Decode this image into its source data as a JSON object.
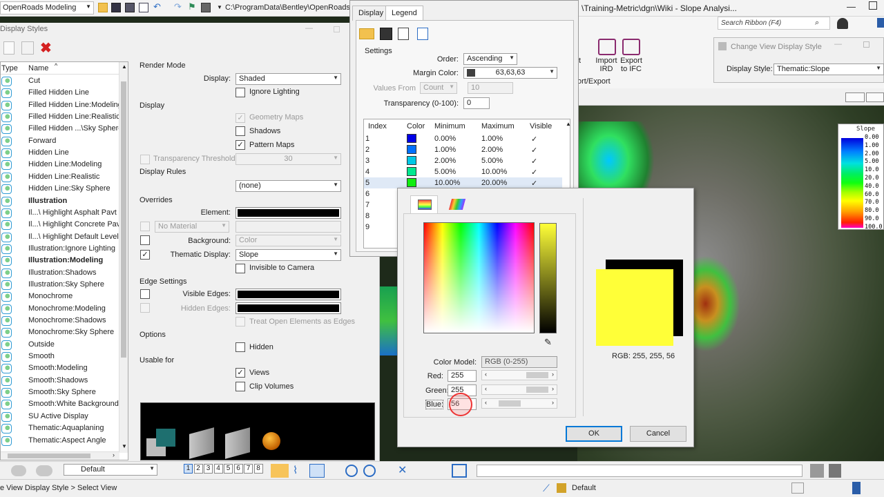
{
  "topbar": {
    "workspace": "OpenRoads Modeling",
    "path": "C:\\ProgramData\\Bentley\\OpenRoads",
    "title": "\\Training-Metric\\dgn\\Wiki - Slope Analysi...",
    "search_placeholder": "Search Ribbon (F4)"
  },
  "ribbon": {
    "frag": "t",
    "import_ird": "Import IRD",
    "import_label1": "Import",
    "import_label2": "IRD",
    "export_label1": "Export",
    "export_label2": "to IFC",
    "group": "ort/Export"
  },
  "change_view": {
    "title": "Change View Display Style",
    "display_style_label": "Display Style:",
    "display_style_value": "Thematic:Slope"
  },
  "display_styles": {
    "title": "Display Styles",
    "col_type": "Type",
    "col_name": "Name",
    "items": [
      "Cut",
      "Filled Hidden Line",
      "Filled Hidden Line:Modeling",
      "Filled Hidden Line:Realistic",
      "Filled Hidden ...\\Sky Sphere",
      "Forward",
      "Hidden Line",
      "Hidden Line:Modeling",
      "Hidden Line:Realistic",
      "Hidden Line:Sky Sphere",
      "Illustration",
      "Il...\\ Highlight Asphalt Pavt",
      "Il...\\ Highlight Concrete Pavt",
      "Il...\\ Highlight Default Level",
      "Illustration:Ignore Lighting",
      "Illustration:Modeling",
      "Illustration:Shadows",
      "Illustration:Sky Sphere",
      "Monochrome",
      "Monochrome:Modeling",
      "Monochrome:Shadows",
      "Monochrome:Sky Sphere",
      "Outside",
      "Smooth",
      "Smooth:Modeling",
      "Smooth:Shadows",
      "Smooth:Sky Sphere",
      "Smooth:White Background",
      "SU Active Display",
      "Thematic:Aquaplaning",
      "Thematic:Aspect Angle"
    ],
    "render_mode": "Render Mode",
    "display_label": "Display:",
    "display_value": "Shaded",
    "ignore_lighting": "Ignore Lighting",
    "display_section": "Display",
    "geometry_maps": "Geometry Maps",
    "shadows": "Shadows",
    "pattern_maps": "Pattern Maps",
    "transparency_threshold": "Transparency Threshold:",
    "transparency_value": "30",
    "display_rules": "Display Rules",
    "display_rules_value": "(none)",
    "overrides": "Overrides",
    "element_label": "Element:",
    "material_value": "No Material",
    "background_label": "Background:",
    "background_value": "Color",
    "thematic_label": "Thematic Display:",
    "thematic_value": "Slope",
    "invisible_camera": "Invisible to Camera",
    "edge_settings": "Edge Settings",
    "visible_edges": "Visible Edges:",
    "hidden_edges": "Hidden Edges:",
    "treat_open": "Treat Open Elements as Edges",
    "options": "Options",
    "hidden": "Hidden",
    "usable_for": "Usable for",
    "views": "Views",
    "clip_volumes": "Clip Volumes"
  },
  "legend_dialog": {
    "tab_display": "Display",
    "tab_legend": "Legend",
    "settings": "Settings",
    "order_label": "Order:",
    "order_value": "Ascending",
    "margin_label": "Margin Color:",
    "margin_value": "63,63,63",
    "values_from_label": "Values From",
    "values_from_value": "Count",
    "values_from_count": "10",
    "transparency_label": "Transparency (0-100):",
    "transparency_value": "0",
    "headers": [
      "Index",
      "Color",
      "Minimum",
      "Maximum",
      "Visible"
    ],
    "rows": [
      {
        "index": "1",
        "color": "#0000e6",
        "min": "0.00%",
        "max": "1.00%",
        "visible": "✓"
      },
      {
        "index": "2",
        "color": "#0070ff",
        "min": "1.00%",
        "max": "2.00%",
        "visible": "✓"
      },
      {
        "index": "3",
        "color": "#00c8e6",
        "min": "2.00%",
        "max": "5.00%",
        "visible": "✓"
      },
      {
        "index": "4",
        "color": "#00e890",
        "min": "5.00%",
        "max": "10.00%",
        "visible": "✓"
      },
      {
        "index": "5",
        "color": "#10ee10",
        "min": "10.00%",
        "max": "20.00%",
        "visible": "✓"
      },
      {
        "index": "6"
      },
      {
        "index": "7"
      },
      {
        "index": "8"
      },
      {
        "index": "9"
      }
    ]
  },
  "color_picker": {
    "color_model_label": "Color Model:",
    "color_model_value": "RGB (0-255)",
    "red_label": "Red:",
    "red_value": "255",
    "green_label": "Green:",
    "green_value": "255",
    "blue_label": "Blue:",
    "blue_value": "56",
    "rgb_text": "RGB: 255, 255, 56",
    "ok": "OK",
    "cancel": "Cancel",
    "new_color": "#ffff38",
    "old_color": "#000000"
  },
  "thematic_legend": {
    "title": "Slope",
    "values": [
      "0.00",
      "1.00",
      "2.00",
      "5.00",
      "10.0",
      "20.0",
      "40.0",
      "60.0",
      "70.0",
      "80.0",
      "90.0",
      "100.0"
    ]
  },
  "bottom": {
    "level_value": "Default",
    "view_numbers": [
      "1",
      "2",
      "3",
      "4",
      "5",
      "6",
      "7",
      "8"
    ],
    "status_text": "e View Display Style > Select View",
    "status_default": "Default"
  }
}
